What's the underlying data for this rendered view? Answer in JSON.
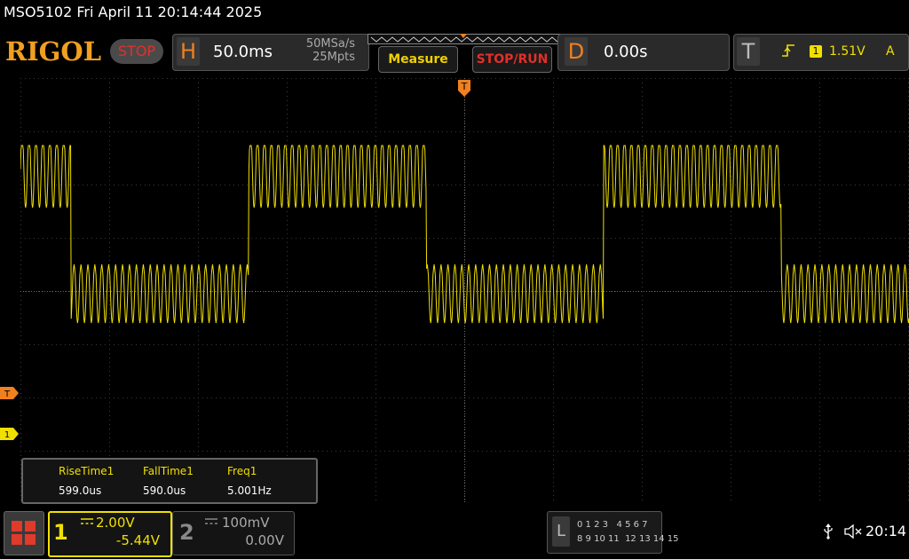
{
  "title_bar": {
    "text": "MSO5102  Fri April 11 20:14:44 2025"
  },
  "header": {
    "brand": "RIGOL",
    "run_state": "STOP",
    "horizontal": {
      "letter": "H",
      "scale": "50.0ms",
      "sample_rate": "50MSa/s",
      "mem_depth": "25Mpts"
    },
    "measure_label": "Measure",
    "stoprun_label": "STOP/RUN",
    "delay": {
      "letter": "D",
      "value": "0.00s"
    },
    "trigger": {
      "letter": "T",
      "edge_icon": "rising-edge-icon",
      "source": "1",
      "level": "1.51V",
      "mode": "A"
    }
  },
  "markers": {
    "trigger_top": "T",
    "trigger_level": "T",
    "channel1": "1"
  },
  "measurements": {
    "items": [
      {
        "name": "RiseTime1",
        "value": "599.0us"
      },
      {
        "name": "FallTime1",
        "value": "590.0us"
      },
      {
        "name": "Freq1",
        "value": "5.001Hz"
      }
    ]
  },
  "channels": {
    "ch1": {
      "number": "1",
      "scale": "2.00V",
      "offset": "-5.44V",
      "color": "#f0e000"
    },
    "ch2": {
      "number": "2",
      "scale": "100mV",
      "offset": "0.00V",
      "color": "#888888"
    }
  },
  "logic": {
    "letter": "L",
    "row1": "0 1 2 3   4 5 6 7",
    "row2": "8 9 10 11  12 13 14 15"
  },
  "status": {
    "time": "20:14"
  },
  "colors": {
    "ch1": "#f0e000",
    "accent": "#f08020",
    "stop": "#e0302a",
    "grid": "#3a3a3a"
  }
}
